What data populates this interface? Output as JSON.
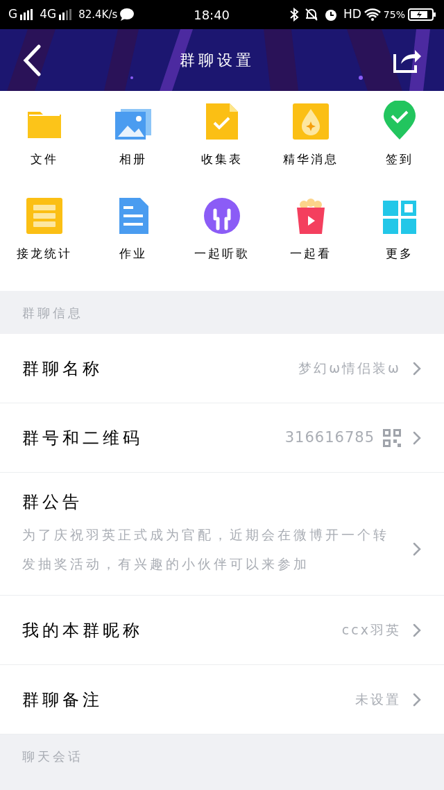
{
  "status_bar": {
    "carrier_1": "G",
    "carrier_2": "4G",
    "speed": "82.4K/s",
    "time": "18:40",
    "hd": "HD",
    "battery": "75%"
  },
  "header": {
    "title": "群聊设置"
  },
  "tools": [
    {
      "label": "文件"
    },
    {
      "label": "相册"
    },
    {
      "label": "收集表"
    },
    {
      "label": "精华消息"
    },
    {
      "label": "签到"
    },
    {
      "label": "接龙统计"
    },
    {
      "label": "作业"
    },
    {
      "label": "一起听歌"
    },
    {
      "label": "一起看"
    },
    {
      "label": "更多"
    }
  ],
  "sections": [
    {
      "title": "群聊信息",
      "rows": [
        {
          "kind": "value",
          "label": "群聊名称",
          "value": "梦幻ω情侣装ω"
        },
        {
          "kind": "qr",
          "label": "群号和二维码",
          "value": "316616785"
        },
        {
          "kind": "note",
          "label": "群公告",
          "value": "为了庆祝羽英正式成为官配，近期会在微博开一个转发抽奖活动，有兴趣的小伙伴可以来参加"
        },
        {
          "kind": "value",
          "label": "我的本群昵称",
          "value": "ccx羽英"
        },
        {
          "kind": "value",
          "label": "群聊备注",
          "value": "未设置"
        }
      ]
    },
    {
      "title": "聊天会话"
    }
  ]
}
